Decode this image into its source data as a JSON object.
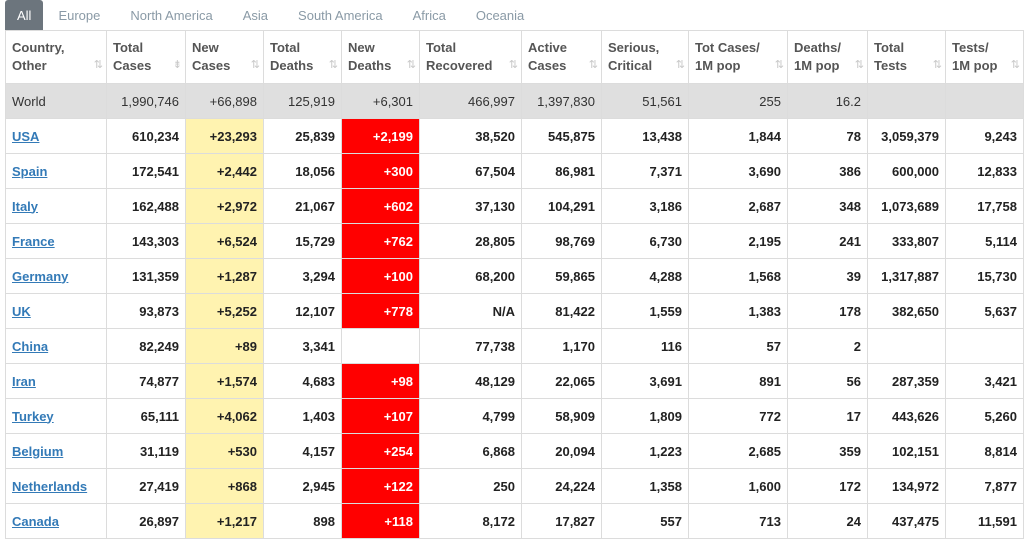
{
  "tabs": [
    "All",
    "Europe",
    "North America",
    "Asia",
    "South America",
    "Africa",
    "Oceania"
  ],
  "active_tab": "All",
  "columns": [
    [
      "Country,",
      "Other"
    ],
    [
      "Total",
      "Cases"
    ],
    [
      "New",
      "Cases"
    ],
    [
      "Total",
      "Deaths"
    ],
    [
      "New",
      "Deaths"
    ],
    [
      "Total",
      "Recovered"
    ],
    [
      "Active",
      "Cases"
    ],
    [
      "Serious,",
      "Critical"
    ],
    [
      "Tot Cases/",
      "1M pop"
    ],
    [
      "Deaths/",
      "1M pop"
    ],
    [
      "Total",
      "Tests"
    ],
    [
      "Tests/",
      "1M pop"
    ]
  ],
  "sort_icons": [
    "⇅",
    "⇟",
    "⇅",
    "⇅",
    "⇅",
    "⇅",
    "⇅",
    "⇅",
    "⇅",
    "⇅",
    "⇅",
    "⇅"
  ],
  "world": [
    "World",
    "1,990,746",
    "+66,898",
    "125,919",
    "+6,301",
    "466,997",
    "1,397,830",
    "51,561",
    "255",
    "16.2",
    "",
    ""
  ],
  "rows": [
    [
      "USA",
      "610,234",
      "+23,293",
      "25,839",
      "+2,199",
      "38,520",
      "545,875",
      "13,438",
      "1,844",
      "78",
      "3,059,379",
      "9,243"
    ],
    [
      "Spain",
      "172,541",
      "+2,442",
      "18,056",
      "+300",
      "67,504",
      "86,981",
      "7,371",
      "3,690",
      "386",
      "600,000",
      "12,833"
    ],
    [
      "Italy",
      "162,488",
      "+2,972",
      "21,067",
      "+602",
      "37,130",
      "104,291",
      "3,186",
      "2,687",
      "348",
      "1,073,689",
      "17,758"
    ],
    [
      "France",
      "143,303",
      "+6,524",
      "15,729",
      "+762",
      "28,805",
      "98,769",
      "6,730",
      "2,195",
      "241",
      "333,807",
      "5,114"
    ],
    [
      "Germany",
      "131,359",
      "+1,287",
      "3,294",
      "+100",
      "68,200",
      "59,865",
      "4,288",
      "1,568",
      "39",
      "1,317,887",
      "15,730"
    ],
    [
      "UK",
      "93,873",
      "+5,252",
      "12,107",
      "+778",
      "N/A",
      "81,422",
      "1,559",
      "1,383",
      "178",
      "382,650",
      "5,637"
    ],
    [
      "China",
      "82,249",
      "+89",
      "3,341",
      "",
      "77,738",
      "1,170",
      "116",
      "57",
      "2",
      "",
      ""
    ],
    [
      "Iran",
      "74,877",
      "+1,574",
      "4,683",
      "+98",
      "48,129",
      "22,065",
      "3,691",
      "891",
      "56",
      "287,359",
      "3,421"
    ],
    [
      "Turkey",
      "65,111",
      "+4,062",
      "1,403",
      "+107",
      "4,799",
      "58,909",
      "1,809",
      "772",
      "17",
      "443,626",
      "5,260"
    ],
    [
      "Belgium",
      "31,119",
      "+530",
      "4,157",
      "+254",
      "6,868",
      "20,094",
      "1,223",
      "2,685",
      "359",
      "102,151",
      "8,814"
    ],
    [
      "Netherlands",
      "27,419",
      "+868",
      "2,945",
      "+122",
      "250",
      "24,224",
      "1,358",
      "1,600",
      "172",
      "134,972",
      "7,877"
    ],
    [
      "Canada",
      "26,897",
      "+1,217",
      "898",
      "+118",
      "8,172",
      "17,827",
      "557",
      "713",
      "24",
      "437,475",
      "11,591"
    ]
  ],
  "colors": {
    "new_cases_bg": "#fff3b0",
    "new_deaths_bg": "#ff0000",
    "world_bg": "#dfdfdf",
    "link": "#337ab7",
    "tab_active_bg": "#6c757d"
  }
}
